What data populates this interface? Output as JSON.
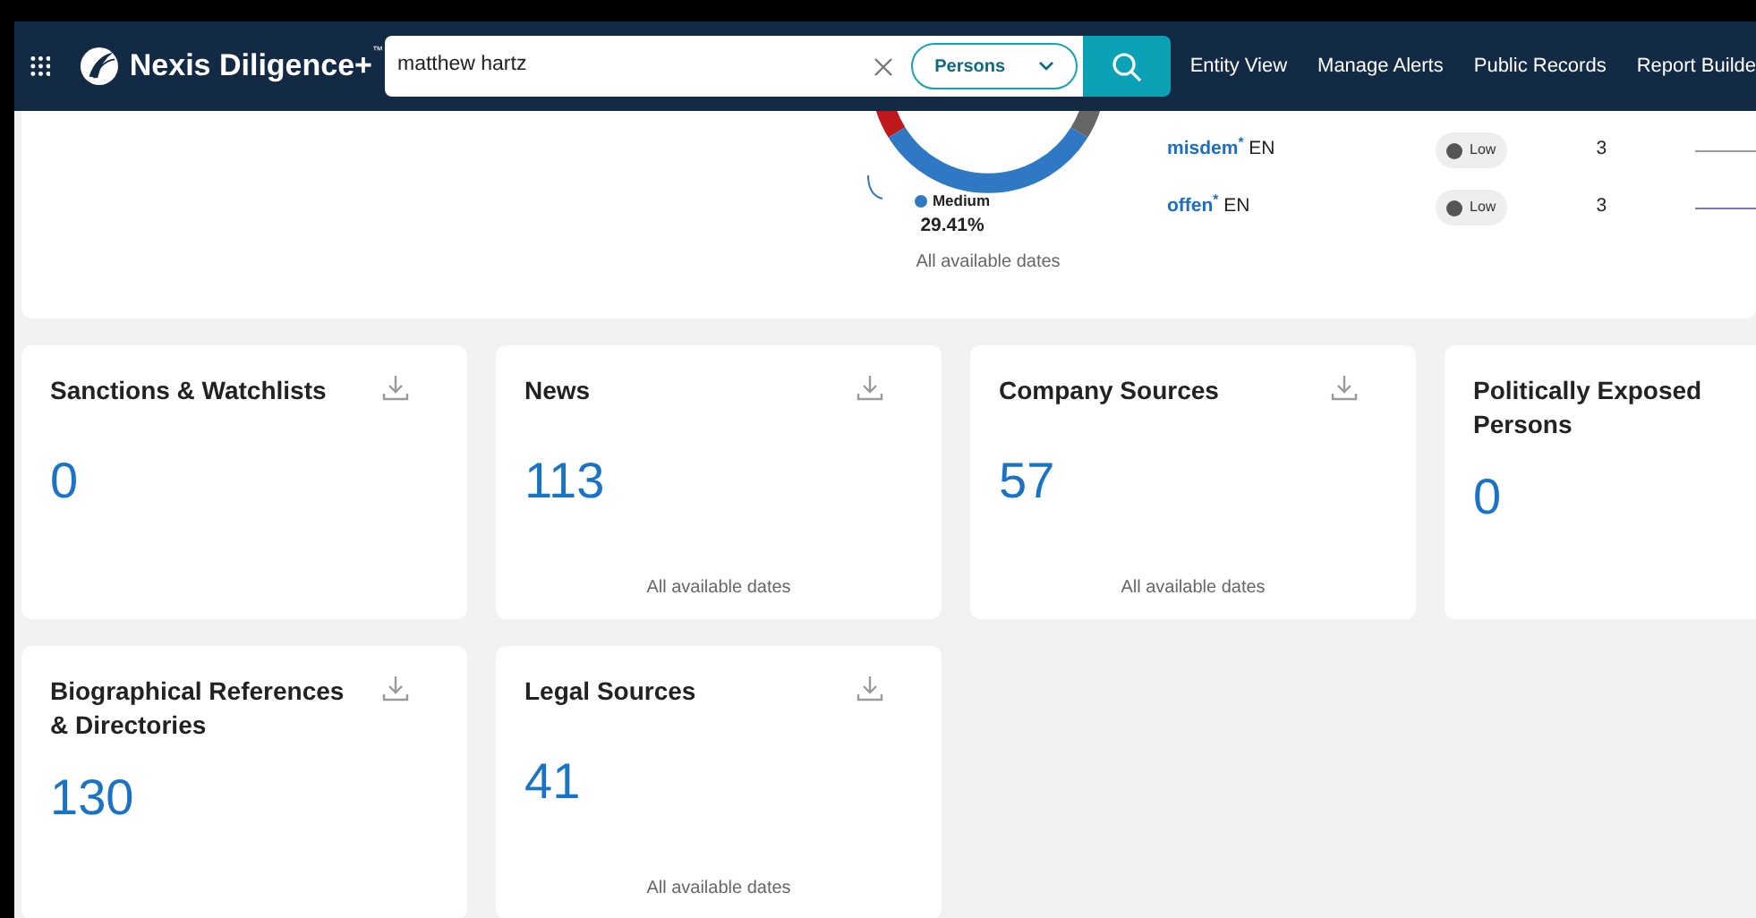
{
  "nav": {
    "brand": "Nexis Diligence+",
    "brand_mark": "™",
    "search": {
      "value": "matthew hartz"
    },
    "category": "Persons",
    "links": [
      "Entity View",
      "Manage Alerts",
      "Public Records",
      "Report Builde"
    ]
  },
  "risk_panel": {
    "legend": {
      "label": "Medium",
      "percent": "29.41%",
      "color": "#2f78c4"
    },
    "footer": "All available dates",
    "terms": [
      {
        "term": "misdem$^{*}$",
        "lang": "EN",
        "level": "Low",
        "count": "3"
      },
      {
        "term": "offen$^{*}$",
        "lang": "EN",
        "level": "Low",
        "count": "3"
      }
    ]
  },
  "cards": [
    {
      "title": "Sanctions & Watchlists",
      "count": "0",
      "download": true
    },
    {
      "title": "News",
      "count": "113",
      "download": true,
      "footer": "All available dates"
    },
    {
      "title": "Company Sources",
      "count": "57",
      "download": true,
      "footer": "All available dates"
    },
    {
      "title": "Politically Exposed Persons",
      "count": "0"
    },
    {
      "title": "Biographical References & Directories",
      "count": "130",
      "download": true
    },
    {
      "title": "Legal Sources",
      "count": "41",
      "download": true,
      "footer": "All available dates"
    }
  ]
}
